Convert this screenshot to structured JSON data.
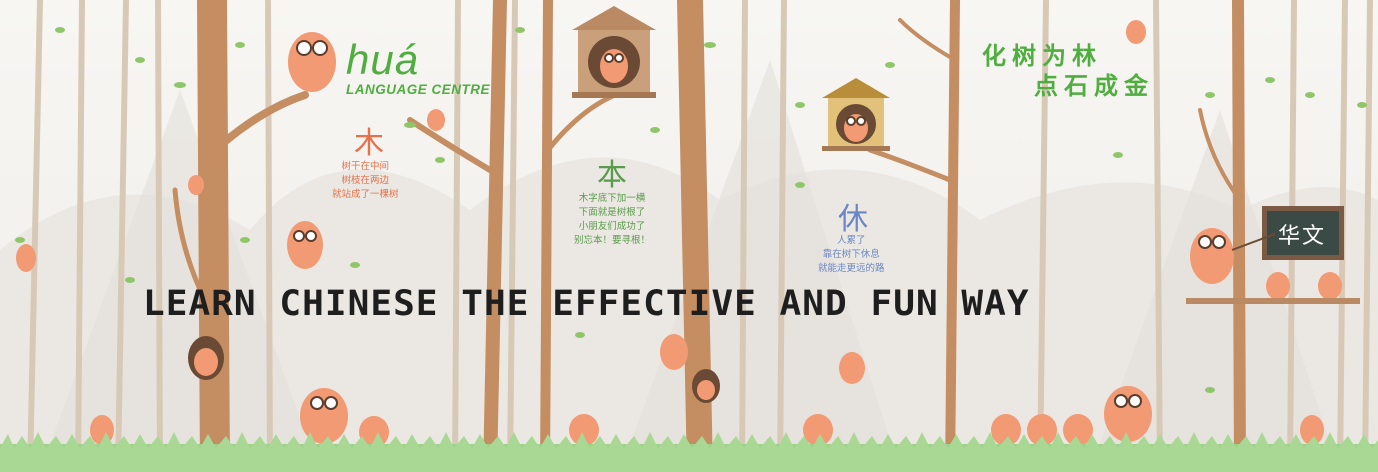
{
  "brand": {
    "name": "huá",
    "subtitle": "LANGUAGE CENTRE"
  },
  "characters": [
    {
      "char": "木",
      "poem": "树干在中间\n树枝在两边\n就站成了一棵树",
      "color": "#e8704a"
    },
    {
      "char": "本",
      "poem": "木字底下加一横\n下面就是树根了\n小朋友们成功了\n别忘本！要寻根！",
      "color": "#5a9a4c"
    },
    {
      "char": "休",
      "poem": "人累了\n靠在树下休息\n就能走更远的路",
      "color": "#6a86c4"
    }
  ],
  "slogan": {
    "line1": "化树为林",
    "line2": "点石成金"
  },
  "headline": "LEARN CHINESE THE EFFECTIVE AND FUN WAY",
  "chalkboard": {
    "text": "华文"
  },
  "colors": {
    "brand_green": "#4fae3f",
    "owl_orange": "#f29a73",
    "trunk_brown": "#c48d62",
    "grass_green": "#9ed18a"
  }
}
